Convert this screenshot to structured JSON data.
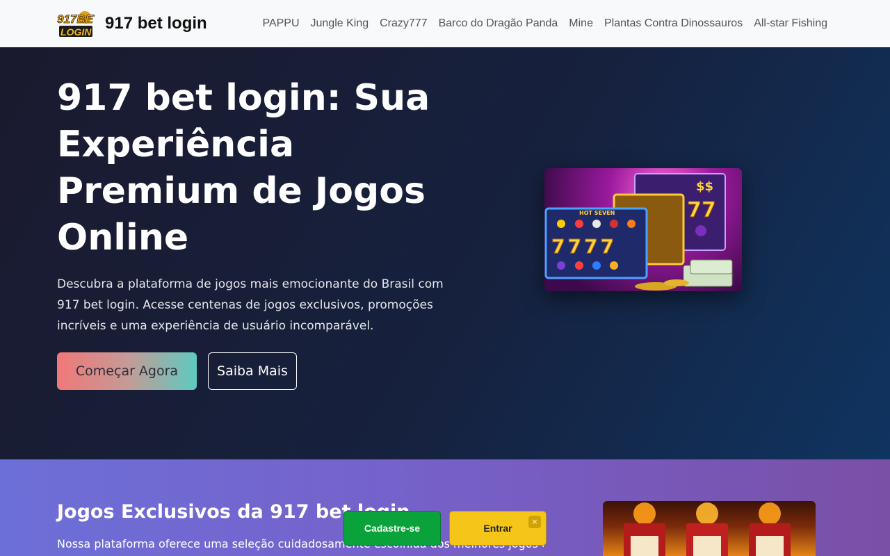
{
  "header": {
    "logo_text_top": "917BET",
    "logo_text_bottom": "LOGIN",
    "brand": "917 bet login",
    "nav": [
      "PAPPU",
      "Jungle King",
      "Crazy777",
      "Barco do Dragão Panda",
      "Mine",
      "Plantas Contra Dinossauros",
      "All-star Fishing"
    ]
  },
  "hero": {
    "title": "917 bet login: Sua Experiência Premium de Jogos Online",
    "description": "Descubra a plataforma de jogos mais emocionante do Brasil com 917 bet login. Acesse centenas de jogos exclusivos, promoções incríveis e uma experiência de usuário incomparável.",
    "primary_button": "Começar Agora",
    "secondary_button": "Saiba Mais",
    "image": {
      "hot_seven": "HOT SEVEN",
      "dollar": "$$",
      "reel_digits": "7777",
      "big_seven": "77"
    }
  },
  "section2": {
    "title": "Jogos Exclusivos da 917 bet login",
    "description": "Nossa plataforma oferece uma seleção cuidadosamente escolhida dos melhores jogos online. De"
  },
  "floating": {
    "signup": "Cadastre-se",
    "login": "Entrar",
    "close": "×"
  },
  "colors": {
    "signup_green": "#0aa23a",
    "login_yellow": "#f5c518",
    "hero_bg": "#16213e"
  }
}
